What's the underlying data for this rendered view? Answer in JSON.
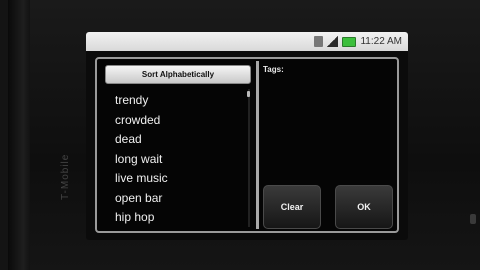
{
  "status_bar": {
    "time": "11:22 AM",
    "icons": [
      "wifi-icon",
      "signal-icon",
      "battery-icon"
    ]
  },
  "device": {
    "brand": "T-Mobile"
  },
  "dialog": {
    "sort_button_label": "Sort Alphabetically",
    "tags": [
      "trendy",
      "crowded",
      "dead",
      "long wait",
      "live music",
      "open bar",
      "hip hop"
    ],
    "tags_label": "Tags:",
    "clear_label": "Clear",
    "ok_label": "OK"
  },
  "colors": {
    "status_bar_bg": "#e4e4e4",
    "dialog_bg": "#050505",
    "dialog_border": "#9a9a9a",
    "battery": "#3cbf3c"
  }
}
